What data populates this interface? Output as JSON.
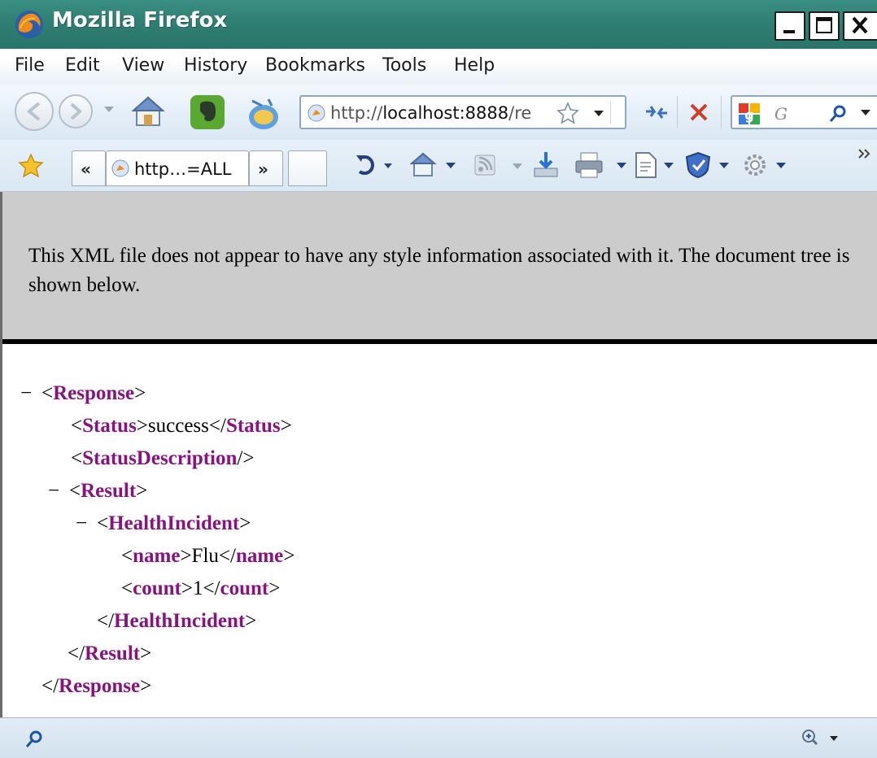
{
  "window": {
    "title": "Mozilla Firefox"
  },
  "menu": [
    "File",
    "Edit",
    "View",
    "History",
    "Bookmarks",
    "Tools",
    "Help"
  ],
  "address": {
    "url_prefix": "http://",
    "url_host": "localhost:8888",
    "url_rest": "/re"
  },
  "search": {
    "engine_hint": "G"
  },
  "tabs": {
    "scroll_left": "«",
    "active_label": "http…=ALL",
    "scroll_right": "»"
  },
  "xml": {
    "notice": "This XML file does not appear to have any style information associated with it. The document tree is shown below.",
    "lines": [
      {
        "minus": "−",
        "open": "<",
        "tag": "Response",
        "close": ">",
        "text": "",
        "end_open": "",
        "end_tag": "",
        "end_close": ""
      },
      {
        "minus": "",
        "open": "<",
        "tag": "Status",
        "close": ">",
        "text": "success",
        "end_open": "</",
        "end_tag": "Status",
        "end_close": ">"
      },
      {
        "minus": "",
        "open": "<",
        "tag": "StatusDescription",
        "close": "/>",
        "text": "",
        "end_open": "",
        "end_tag": "",
        "end_close": ""
      },
      {
        "minus": "−",
        "open": "<",
        "tag": "Result",
        "close": ">",
        "text": "",
        "end_open": "",
        "end_tag": "",
        "end_close": ""
      },
      {
        "minus": "−",
        "open": "<",
        "tag": "HealthIncident",
        "close": ">",
        "text": "",
        "end_open": "",
        "end_tag": "",
        "end_close": ""
      },
      {
        "minus": "",
        "open": "<",
        "tag": "name",
        "close": ">",
        "text": "Flu",
        "end_open": "</",
        "end_tag": "name",
        "end_close": ">"
      },
      {
        "minus": "",
        "open": "<",
        "tag": "count",
        "close": ">",
        "text": "1",
        "end_open": "</",
        "end_tag": "count",
        "end_close": ">"
      },
      {
        "minus": "",
        "open": "</",
        "tag": "HealthIncident",
        "close": ">",
        "text": "",
        "end_open": "",
        "end_tag": "",
        "end_close": ""
      },
      {
        "minus": "",
        "open": "</",
        "tag": "Result",
        "close": ">",
        "text": "",
        "end_open": "",
        "end_tag": "",
        "end_close": ""
      },
      {
        "minus": "",
        "open": "</",
        "tag": "Response",
        "close": ">",
        "text": "",
        "end_open": "",
        "end_tag": "",
        "end_close": ""
      }
    ]
  },
  "colors": {
    "xml_tag": "#881280",
    "titlebar": "#2f7f73"
  },
  "icons": [
    "firefox-logo-icon",
    "back-icon",
    "forward-icon",
    "home-icon",
    "evernote-icon",
    "blog-icon",
    "page-favicon-icon",
    "bookmark-star-icon",
    "reload-icon",
    "stop-icon",
    "google-icon",
    "search-icon",
    "bookmarks-star-icon",
    "refresh-icon",
    "rss-icon",
    "download-icon",
    "print-icon",
    "page-icon",
    "safety-icon",
    "settings-gear-icon",
    "status-search-icon",
    "zoom-icon"
  ]
}
